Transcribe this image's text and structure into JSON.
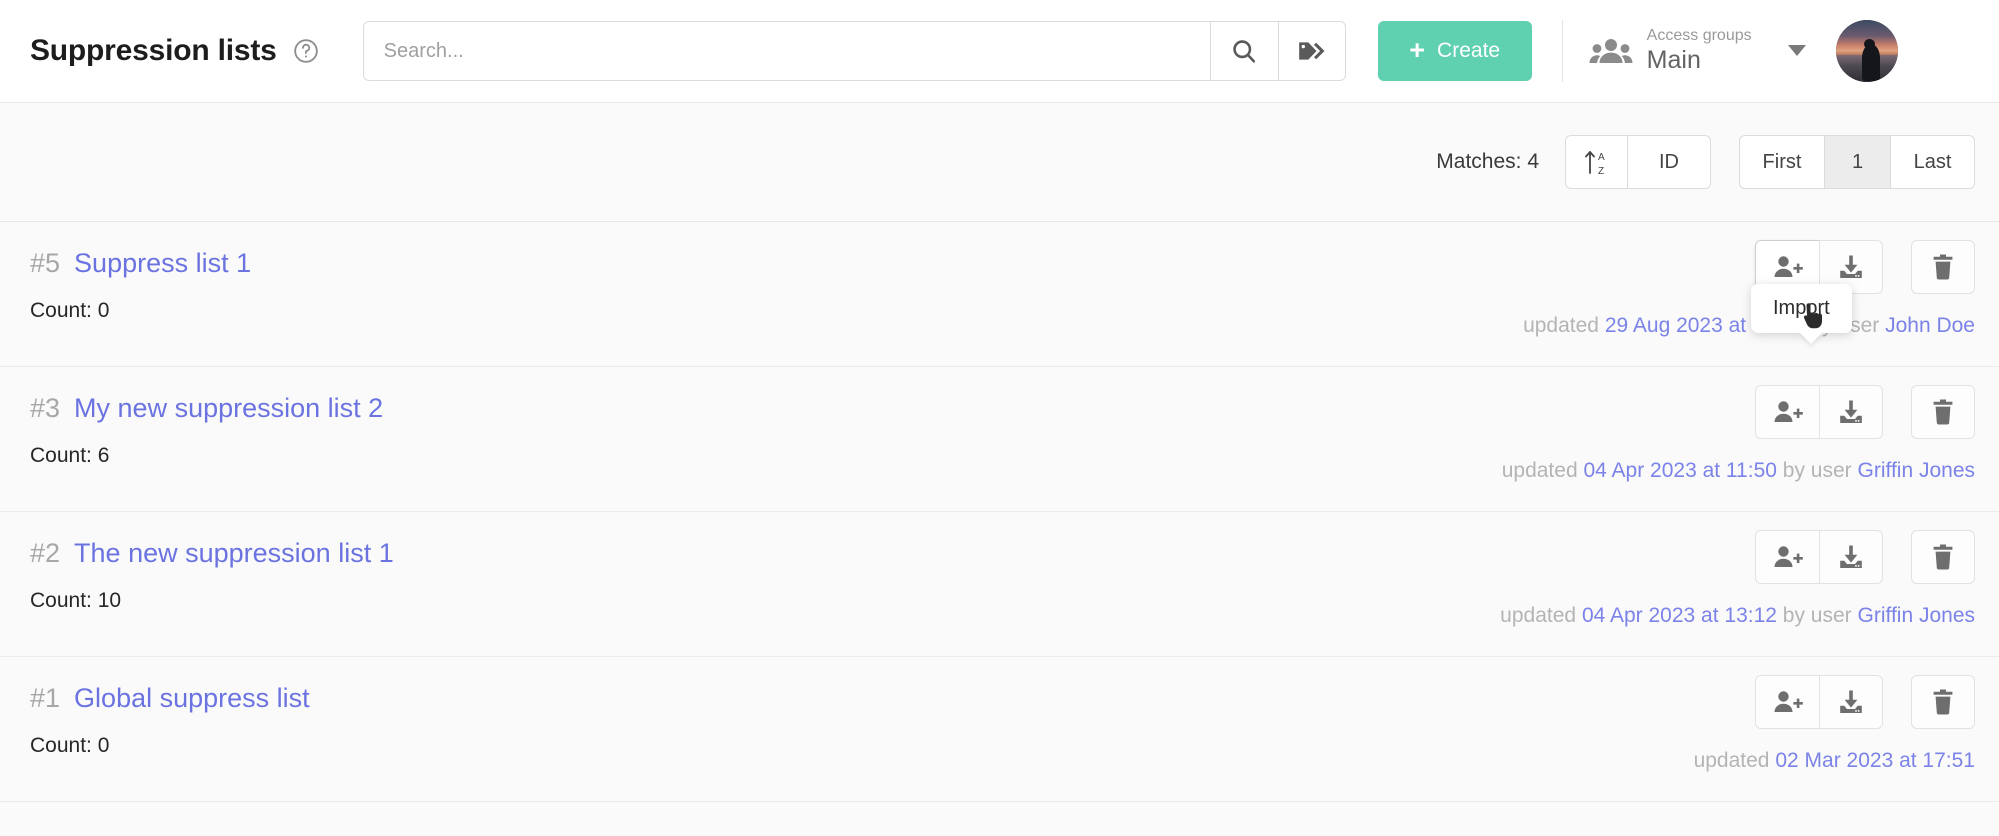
{
  "header": {
    "title": "Suppression lists",
    "help_icon": "question-mark-circle-icon",
    "search": {
      "value": "",
      "placeholder": "Search...",
      "search_icon": "magnifier-icon",
      "tag_icon": "tags-icon"
    },
    "create_button": {
      "label": "Create",
      "icon": "plus-icon",
      "color": "#5fd0b0"
    },
    "access_groups": {
      "label": "Access groups",
      "value": "Main",
      "icon": "people-group-icon",
      "caret": "chevron-down-icon"
    },
    "avatar": {
      "alt": "user-avatar"
    }
  },
  "toolbar": {
    "matches_label": "Matches: 4",
    "sort_icon": "sort-az-ascending-icon",
    "sort_field_label": "ID",
    "pagination": {
      "first_label": "First",
      "current_page": "1",
      "last_label": "Last"
    }
  },
  "tooltip": {
    "text": "Import"
  },
  "row_actions": {
    "import_icon": "person-add-icon",
    "export_icon": "download-icon",
    "delete_icon": "trash-icon",
    "import_label": "Import",
    "export_label": "Export",
    "delete_label": "Delete"
  },
  "list": {
    "items": [
      {
        "id": "#5",
        "title": "Suppress list 1",
        "count_label": "Count: 0",
        "updated_prefix": "updated",
        "updated_date": "29 Aug 2023 at 17:30",
        "by_prefix": "by user",
        "user": "John Doe",
        "hovered": true
      },
      {
        "id": "#3",
        "title": "My new suppression list 2",
        "count_label": "Count: 6",
        "updated_prefix": "updated",
        "updated_date": "04 Apr 2023 at 11:50",
        "by_prefix": "by user",
        "user": "Griffin Jones",
        "hovered": false
      },
      {
        "id": "#2",
        "title": "The new suppression list 1",
        "count_label": "Count: 10",
        "updated_prefix": "updated",
        "updated_date": "04 Apr 2023 at 13:12",
        "by_prefix": "by user",
        "user": "Griffin Jones",
        "hovered": false
      },
      {
        "id": "#1",
        "title": "Global suppress list",
        "count_label": "Count: 0",
        "updated_prefix": "updated",
        "updated_date": "02 Mar 2023 at 17:51",
        "by_prefix": "",
        "user": "",
        "hovered": false
      }
    ]
  }
}
